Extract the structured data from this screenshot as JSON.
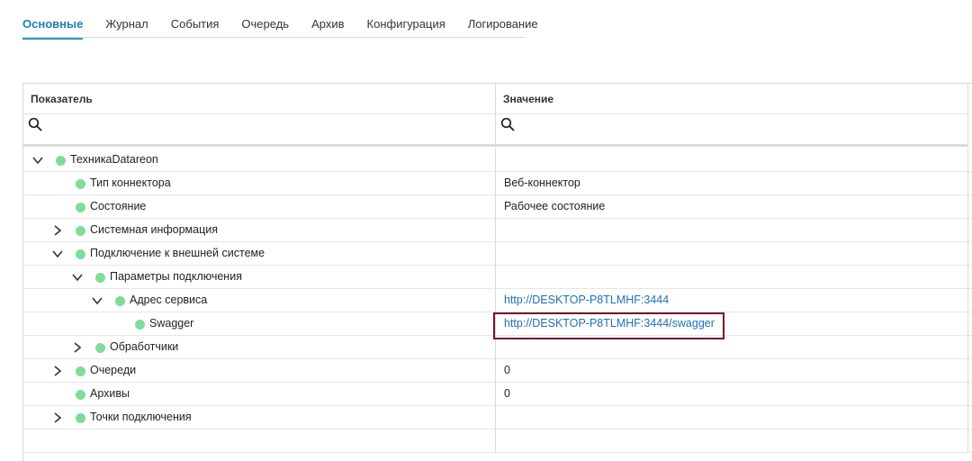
{
  "tabs": [
    {
      "label": "Основные",
      "active": true
    },
    {
      "label": "Журнал"
    },
    {
      "label": "События"
    },
    {
      "label": "Очередь"
    },
    {
      "label": "Архив"
    },
    {
      "label": "Конфигурация"
    },
    {
      "label": "Логирование"
    }
  ],
  "grid": {
    "header": {
      "indicator": "Показатель",
      "value": "Значение"
    },
    "filter": {
      "indicator_value": "",
      "value_value": ""
    },
    "rows": [
      {
        "label": "ТехникаDatareon",
        "value": "",
        "level": 0,
        "toggle": "expanded"
      },
      {
        "label": "Тип коннектора",
        "value": "Веб-коннектор",
        "level": 1,
        "toggle": "none"
      },
      {
        "label": "Состояние",
        "value": "Рабочее состояние",
        "level": 1,
        "toggle": "none"
      },
      {
        "label": "Системная информация",
        "value": "",
        "level": 1,
        "toggle": "collapsed"
      },
      {
        "label": "Подключение к внешней системе",
        "value": "",
        "level": 1,
        "toggle": "expanded"
      },
      {
        "label": "Параметры подключения",
        "value": "",
        "level": 2,
        "toggle": "expanded"
      },
      {
        "label": "Адрес сервиса",
        "value": "http://DESKTOP-P8TLMHF:3444",
        "level": 3,
        "toggle": "expanded",
        "is_link": true
      },
      {
        "label": "Swagger",
        "value": "http://DESKTOP-P8TLMHF:3444/swagger",
        "level": 4,
        "toggle": "none",
        "is_link": true,
        "highlighted": true
      },
      {
        "label": "Обработчики",
        "value": "",
        "level": 2,
        "toggle": "collapsed"
      },
      {
        "label": "Очереди",
        "value": "0",
        "level": 1,
        "toggle": "collapsed"
      },
      {
        "label": "Архивы",
        "value": "0",
        "level": 1,
        "toggle": "none"
      },
      {
        "label": "Точки подключения",
        "value": "",
        "level": 1,
        "toggle": "collapsed"
      },
      {
        "label": "",
        "value": "",
        "level": 0,
        "toggle": "none"
      }
    ]
  },
  "colors": {
    "accent": "#1f7fb0",
    "status_dot": "#7fdc9b",
    "link": "#1f6fb4",
    "highlight_border": "#7a1123"
  },
  "icons": {
    "search": "search-icon",
    "expanded": "chevron-down-icon",
    "collapsed": "chevron-right-icon",
    "status": "status-dot-icon"
  }
}
